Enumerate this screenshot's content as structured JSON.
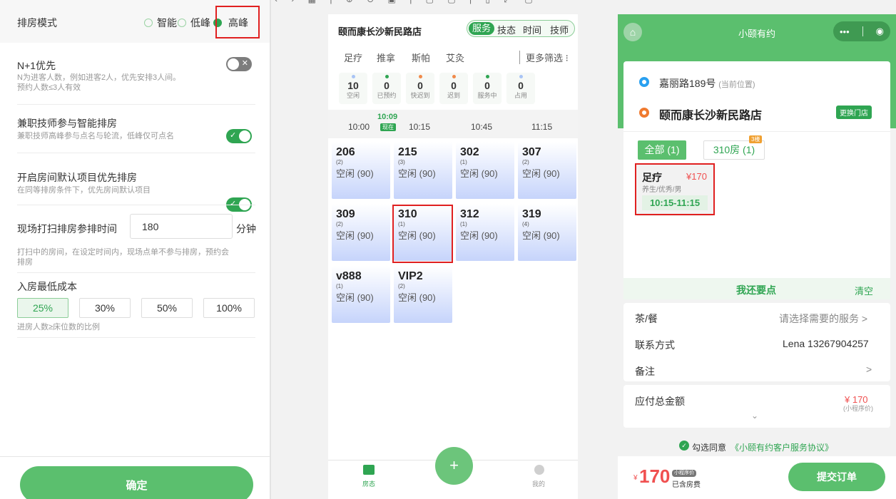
{
  "left": {
    "mode_label": "排房模式",
    "mode_options": [
      "智能",
      "低峰",
      "高峰"
    ],
    "n1_title": "N+1优先",
    "n1_desc1": "N为进客人数，例如进客2人，优先安排3人间。",
    "n1_desc2": "预约人数≤3人有效",
    "parttime_title": "兼职技师参与智能排房",
    "parttime_desc": "兼职技师高峰参与点名与轮流，低峰仅可点名",
    "default_title": "开启房间默认项目优先排房",
    "default_desc": "在同等排房条件下，优先房间默认项目",
    "clock_title": "现场打扫排房参排时间",
    "clock_value": "180",
    "clock_unit": "分钟",
    "clock_desc1": "打扫中的房间，在设定时间内，现场点单不参与排房，预约会",
    "clock_desc2": "排房",
    "cost_title": "入房最低成本",
    "cost_options": [
      "25%",
      "30%",
      "50%",
      "100%"
    ],
    "cost_desc": "进房人数≥床位数的比例",
    "confirm": "确定"
  },
  "mid": {
    "store": "颐而康长沙新民路店",
    "seg": [
      "服务",
      "技态",
      "时间",
      "技师"
    ],
    "cats": [
      "足疗",
      "推拿",
      "斯帕",
      "艾灸"
    ],
    "more": "更多筛选",
    "stats": [
      {
        "num": "10",
        "name": "空闲",
        "color": "#a9c4f5"
      },
      {
        "num": "0",
        "name": "已预约",
        "color": "#2fa552"
      },
      {
        "num": "0",
        "name": "快迟到",
        "color": "#f08a4b"
      },
      {
        "num": "0",
        "name": "迟到",
        "color": "#f08a4b"
      },
      {
        "num": "0",
        "name": "服务中",
        "color": "#2fa552"
      },
      {
        "num": "0",
        "name": "占用",
        "color": "#a9c4f5"
      }
    ],
    "now_time": "10:09",
    "now_label": "现在",
    "times": [
      "10:00",
      "10:15",
      "10:45",
      "11:15"
    ],
    "rooms": [
      {
        "no": "206",
        "cap": "(2)",
        "status": "空闲 (90)"
      },
      {
        "no": "215",
        "cap": "(3)",
        "status": "空闲 (90)"
      },
      {
        "no": "302",
        "cap": "(1)",
        "status": "空闲 (90)"
      },
      {
        "no": "307",
        "cap": "(2)",
        "status": "空闲 (90)"
      },
      {
        "no": "309",
        "cap": "(2)",
        "status": "空闲 (90)"
      },
      {
        "no": "310",
        "cap": "(1)",
        "status": "空闲 (90)"
      },
      {
        "no": "312",
        "cap": "(1)",
        "status": "空闲 (90)"
      },
      {
        "no": "319",
        "cap": "(4)",
        "status": "空闲 (90)"
      },
      {
        "no": "v888",
        "cap": "(1)",
        "status": "空闲 (90)"
      },
      {
        "no": "VIP2",
        "cap": "(2)",
        "status": "空闲 (90)"
      }
    ],
    "tab_left": "房态",
    "tab_right": "我的",
    "fab": "+"
  },
  "right": {
    "title": "小颐有约",
    "capsule_dots": "•••",
    "location": "嘉丽路189号",
    "location_tag": "(当前位置)",
    "store": "颐而康长沙新民路店",
    "change_store": "更换门店",
    "tab_all": "全部 (1)",
    "tab_room": "310房 (1)",
    "room_badge": "3楼",
    "service_name": "足疗",
    "service_price": "¥170",
    "service_desc": "养生/优秀/男",
    "service_time": "10:15-11:15",
    "want_more": "我还要点",
    "clear": "清空",
    "tea_label": "茶/餐",
    "tea_value": "请选择需要的服务 >",
    "contact_label": "联系方式",
    "contact_value": "Lena 13267904257",
    "note_label": "备注",
    "note_value": ">",
    "total_label": "应付总金额",
    "total_value": "¥ 170",
    "total_sub": "(小程序价)",
    "chevron": "⌄",
    "agree_prefix": "勾选同意",
    "agree_link": "《小颐有约客户服务协议》",
    "bottom_price_sym": "¥",
    "bottom_price": "170",
    "bottom_tag": "小程序价",
    "bottom_sub": "已含房费",
    "submit": "提交订单"
  }
}
